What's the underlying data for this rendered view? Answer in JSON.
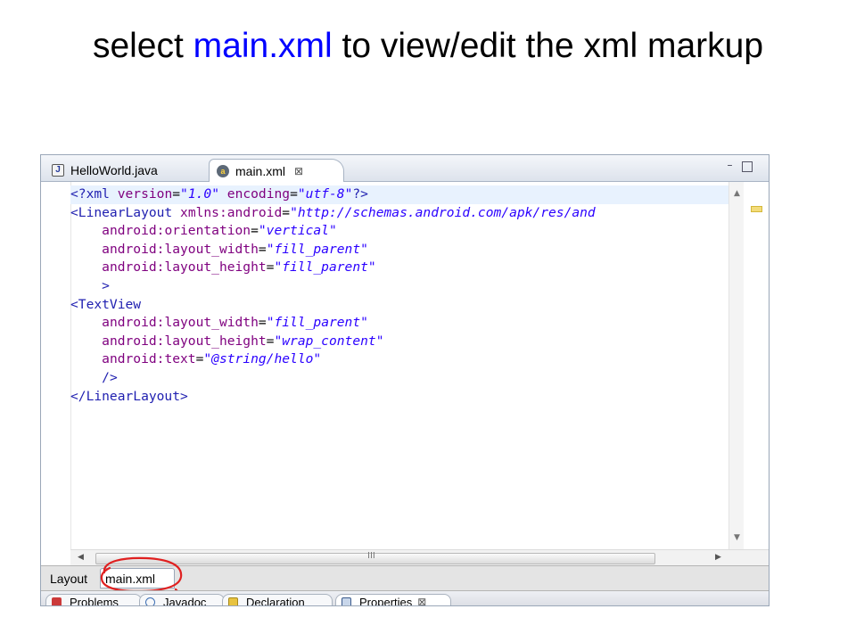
{
  "slide": {
    "title_prefix": "select ",
    "title_highlight": "main.xml",
    "title_suffix": " to view/edit the xml markup"
  },
  "colors": {
    "highlight": "#0000ff",
    "annotation": "#e02020",
    "xml_tag": "#1f1fb0",
    "xml_attr": "#7f007f",
    "xml_value": "#2a00ff"
  },
  "editor_tabs": [
    {
      "label": "HelloWorld.java",
      "icon": "java-file-icon",
      "active": false
    },
    {
      "label": "main.xml",
      "icon": "xml-file-icon",
      "active": true,
      "close_glyph": "⊠"
    }
  ],
  "window_controls": {
    "minimize": "–",
    "maximize": ""
  },
  "code": {
    "l1": {
      "open": "<?xml",
      "a1": "version",
      "v1": "\"1.0\"",
      "a2": "encoding",
      "v2": "\"utf-8\"",
      "close": "?>"
    },
    "l2": {
      "open": "<LinearLayout",
      "a1": "xmlns:android",
      "v1": "\"http://schemas.android.com/apk/res/and"
    },
    "l3": {
      "a1": "android:orientation",
      "v1": "\"vertical\""
    },
    "l4": {
      "a1": "android:layout_width",
      "v1": "\"fill_parent\""
    },
    "l5": {
      "a1": "android:layout_height",
      "v1": "\"fill_parent\""
    },
    "l6": {
      "close": ">"
    },
    "l7": {
      "open": "<TextView"
    },
    "l8": {
      "a1": "android:layout_width",
      "v1": "\"fill_parent\""
    },
    "l9": {
      "a1": "android:layout_height",
      "v1": "\"wrap_content\""
    },
    "l10": {
      "a1": "android:text",
      "v1": "\"@string/hello\""
    },
    "l11": {
      "close": "/>"
    },
    "l12": {
      "open": "</LinearLayout>"
    }
  },
  "scrollbar": {
    "grip": "III",
    "up": "▲",
    "down": "▼",
    "left": "◀",
    "right": "▶"
  },
  "bottom_tabs": [
    {
      "label": "Layout",
      "active": false
    },
    {
      "label": "main.xml",
      "active": true
    }
  ],
  "view_tabs": [
    {
      "label": "Problems",
      "icon": "problems-icon"
    },
    {
      "label": "Javadoc",
      "icon": "javadoc-icon"
    },
    {
      "label": "Declaration",
      "icon": "declaration-icon"
    },
    {
      "label": "Properties",
      "icon": "properties-icon",
      "close_glyph": "⊠"
    }
  ]
}
